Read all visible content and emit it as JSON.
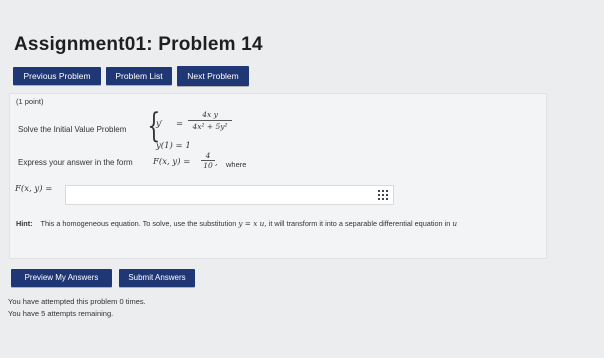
{
  "page": {
    "title": "Assignment01: Problem 14"
  },
  "nav": {
    "previous": "Previous Problem",
    "list": "Problem List",
    "next": "Next Problem"
  },
  "problem": {
    "points": "(1 point)",
    "solve_label": "Solve the Initial Value Problem",
    "ode_lhs": "y′",
    "ode_eq": "=",
    "ode_num": "4x y",
    "ode_den": "4x² + 5y²",
    "initial_condition": "y(1) = 1",
    "express_text": "Express your answer in the form",
    "form_expr": "F(x, y) =",
    "form_num": "4",
    "form_den": "10",
    "form_comma": ",",
    "where": "where"
  },
  "answer": {
    "label": "F(x, y) =",
    "value": "",
    "icon": "grid-icon"
  },
  "hint": {
    "label": "Hint:",
    "text1": "This a homogeneous equation. To solve, use the substitution",
    "sub": "y = x u,",
    "text2": "it will transform it into a separable differential equation in",
    "var": "u"
  },
  "actions": {
    "preview": "Preview My Answers",
    "submit": "Submit Answers"
  },
  "status": {
    "attempted": "You have attempted this problem 0 times.",
    "remaining": "You have 5 attempts remaining."
  },
  "colors": {
    "button": "#1f3775",
    "background": "#ecedef",
    "panel": "#f3f4f5"
  }
}
